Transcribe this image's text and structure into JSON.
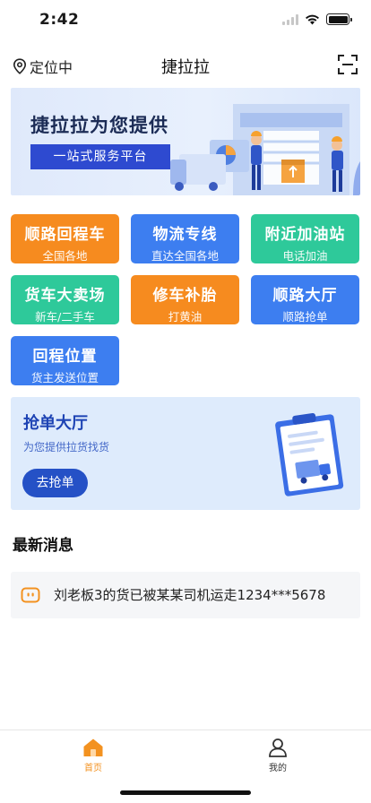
{
  "status_bar": {
    "time": "2:42",
    "signal_icon": "cellular-signal-icon",
    "wifi_icon": "wifi-icon",
    "battery_icon": "battery-icon"
  },
  "nav": {
    "location_label": "定位中",
    "location_icon": "location-pin-icon",
    "title": "捷拉拉",
    "scan_icon": "scan-icon"
  },
  "banner": {
    "title": "捷拉拉为您提供",
    "tagline": "一站式服务平台"
  },
  "services": [
    {
      "title": "顺路回程车",
      "subtitle": "全国各地",
      "color": "#f68b1f"
    },
    {
      "title": "物流专线",
      "subtitle": "直达全国各地",
      "color": "#3d7ef0"
    },
    {
      "title": "附近加油站",
      "subtitle": "电话加油",
      "color": "#2ec99a"
    },
    {
      "title": "货车大卖场",
      "subtitle": "新车/二手车",
      "color": "#2ec99a"
    },
    {
      "title": "修车补胎",
      "subtitle": "打黄油",
      "color": "#f68b1f"
    },
    {
      "title": "顺路大厅",
      "subtitle": "顺路抢单",
      "color": "#3d7ef0"
    },
    {
      "title": "回程位置",
      "subtitle": "货主发送位置",
      "color": "#3d7ef0"
    }
  ],
  "grab_hall": {
    "title": "抢单大厅",
    "subtitle": "为您提供拉货找货",
    "button_label": "去抢单"
  },
  "news": {
    "heading": "最新消息",
    "items": [
      {
        "text": "刘老板3的货已被某某司机运走1234***5678",
        "icon": "notice-icon"
      }
    ]
  },
  "tab_bar": {
    "tabs": [
      {
        "label": "首页",
        "icon": "home-icon",
        "active": true
      },
      {
        "label": "我的",
        "icon": "user-icon",
        "active": false
      }
    ],
    "active_color": "#f39220"
  }
}
